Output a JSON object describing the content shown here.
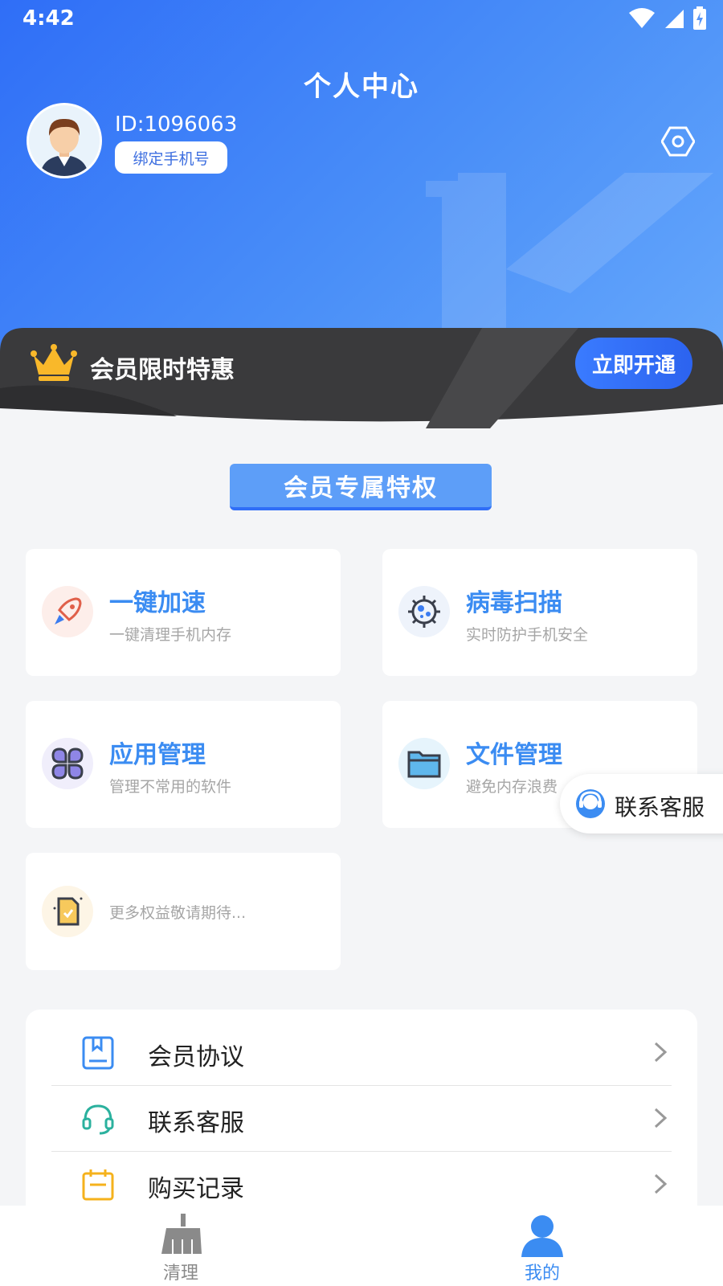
{
  "status_bar": {
    "time": "4:42"
  },
  "header": {
    "title": "个人中心",
    "user_id": "ID:1096063",
    "bind_phone_label": "绑定手机号"
  },
  "vip_banner": {
    "label": "会员限时特惠",
    "open_button": "立即开通"
  },
  "privileges": {
    "section_title": "会员专属特权",
    "cards": [
      {
        "title": "一键加速",
        "subtitle": "一键清理手机内存",
        "icon": "rocket-icon"
      },
      {
        "title": "病毒扫描",
        "subtitle": "实时防护手机安全",
        "icon": "virus-icon"
      },
      {
        "title": "应用管理",
        "subtitle": "管理不常用的软件",
        "icon": "app-grid-icon"
      },
      {
        "title": "文件管理",
        "subtitle": "避免内存浪费",
        "icon": "folder-icon"
      }
    ],
    "more_text": "更多权益敬请期待..."
  },
  "float_service": {
    "label": "联系客服"
  },
  "menu": {
    "items": [
      {
        "label": "会员协议",
        "icon": "book-icon"
      },
      {
        "label": "联系客服",
        "icon": "headset-icon"
      },
      {
        "label": "购买记录",
        "icon": "calendar-icon"
      }
    ]
  },
  "tab_bar": {
    "tabs": [
      {
        "label": "清理",
        "active": false
      },
      {
        "label": "我的",
        "active": true
      }
    ],
    "active_color": "#3b8cf2",
    "inactive_color": "#8a8a8a"
  },
  "colors": {
    "primary": "#3b8cf2",
    "header_gradient_start": "#2f6ef7",
    "header_gradient_end": "#66a8fb",
    "banner_dark": "#3a3a3c",
    "subtext": "#a6a6a6"
  }
}
